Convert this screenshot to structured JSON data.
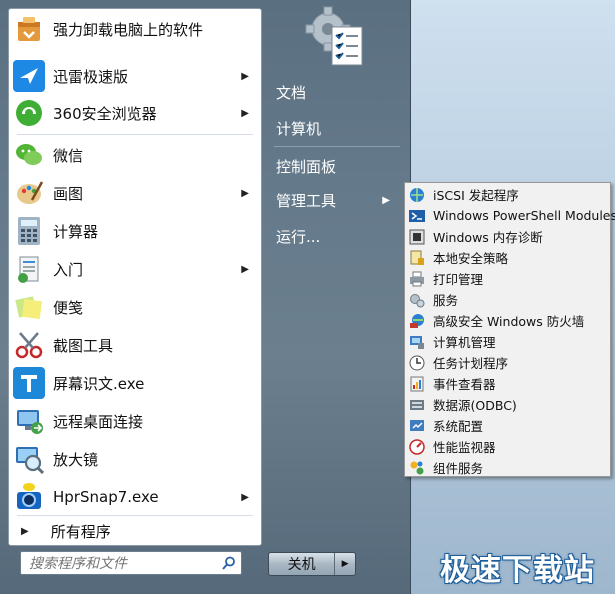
{
  "programs": [
    {
      "label": "强力卸载电脑上的软件",
      "icon": "uninstall-box-icon",
      "has_submenu": false
    },
    {
      "label": "迅雷极速版",
      "icon": "thunder-bird-icon",
      "has_submenu": true
    },
    {
      "label": "360安全浏览器",
      "icon": "browser-360-icon",
      "has_submenu": true
    },
    {
      "label": "微信",
      "icon": "wechat-icon",
      "has_submenu": false
    },
    {
      "label": "画图",
      "icon": "paint-palette-icon",
      "has_submenu": true
    },
    {
      "label": "计算器",
      "icon": "calculator-icon",
      "has_submenu": false
    },
    {
      "label": "入门",
      "icon": "getting-started-icon",
      "has_submenu": true
    },
    {
      "label": "便笺",
      "icon": "sticky-notes-icon",
      "has_submenu": false
    },
    {
      "label": "截图工具",
      "icon": "scissors-icon",
      "has_submenu": false
    },
    {
      "label": "屏幕识文.exe",
      "icon": "text-t-icon",
      "has_submenu": false
    },
    {
      "label": "远程桌面连接",
      "icon": "remote-desktop-icon",
      "has_submenu": false
    },
    {
      "label": "放大镜",
      "icon": "magnifier-icon",
      "has_submenu": false
    },
    {
      "label": "HprSnap7.exe",
      "icon": "camera-icon",
      "has_submenu": true
    }
  ],
  "all_programs_label": "所有程序",
  "search": {
    "placeholder": "搜索程序和文件"
  },
  "right_items": [
    {
      "label": "文档",
      "has_submenu": false
    },
    {
      "label": "计算机",
      "has_submenu": false
    },
    {
      "label": "控制面板",
      "has_submenu": false
    },
    {
      "label": "管理工具",
      "has_submenu": true
    },
    {
      "label": "运行...",
      "has_submenu": false
    }
  ],
  "shutdown": {
    "label": "关机"
  },
  "admin_tools_submenu": [
    {
      "label": "iSCSI 发起程序",
      "icon": "globe-icon"
    },
    {
      "label": "Windows PowerShell Modules",
      "icon": "powershell-icon"
    },
    {
      "label": "Windows 内存诊断",
      "icon": "memory-chip-icon"
    },
    {
      "label": "本地安全策略",
      "icon": "security-policy-icon"
    },
    {
      "label": "打印管理",
      "icon": "printer-icon"
    },
    {
      "label": "服务",
      "icon": "gears-icon"
    },
    {
      "label": "高级安全 Windows 防火墙",
      "icon": "firewall-icon"
    },
    {
      "label": "计算机管理",
      "icon": "computer-management-icon"
    },
    {
      "label": "任务计划程序",
      "icon": "clock-icon"
    },
    {
      "label": "事件查看器",
      "icon": "event-viewer-icon"
    },
    {
      "label": "数据源(ODBC)",
      "icon": "database-icon"
    },
    {
      "label": "系统配置",
      "icon": "system-config-icon"
    },
    {
      "label": "性能监视器",
      "icon": "performance-icon"
    },
    {
      "label": "组件服务",
      "icon": "component-services-icon"
    }
  ],
  "watermark": "极速下载站",
  "colors": {
    "accent": "#1e5f9a",
    "menu_bg": "#64798a",
    "submenu_bg": "#f1f1f1"
  }
}
